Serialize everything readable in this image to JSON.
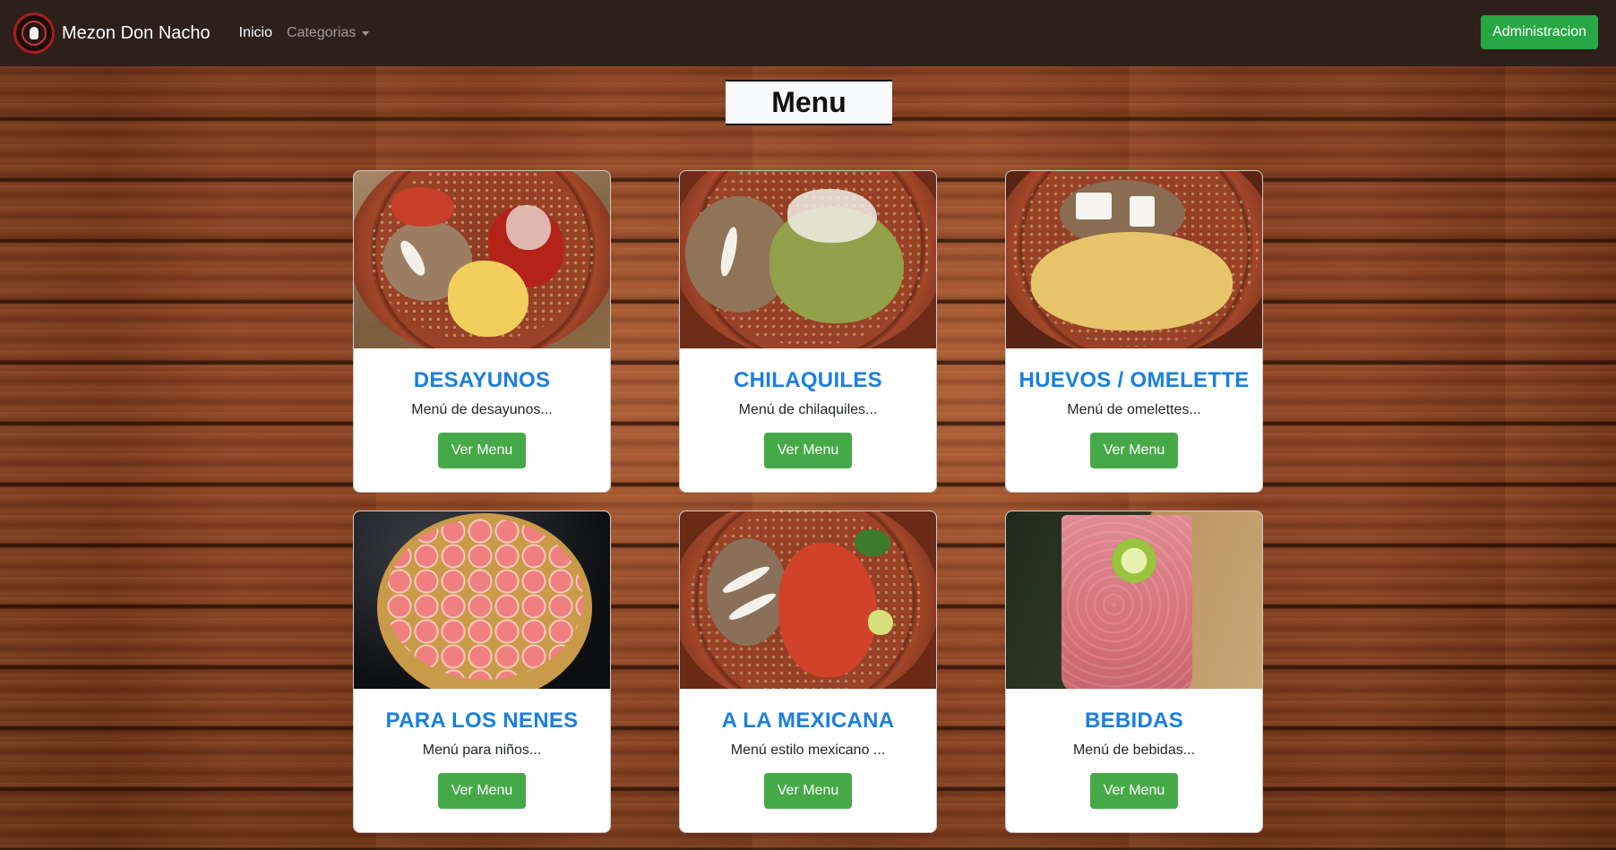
{
  "navbar": {
    "brand": "Mezon Don Nacho",
    "links": [
      {
        "label": "Inicio",
        "active": true
      },
      {
        "label": "Categorias",
        "dropdown": true
      }
    ],
    "admin_button": "Administracion"
  },
  "page_title": "Menu",
  "cards": [
    {
      "title": "DESAYUNOS",
      "text": "Menú de desayunos...",
      "button": "Ver Menu",
      "image": "breakfast-plate"
    },
    {
      "title": "CHILAQUILES",
      "text": "Menú de chilaquiles...",
      "button": "Ver Menu",
      "image": "chilaquiles-plate"
    },
    {
      "title": "HUEVOS / OMELETTE",
      "text": "Menú de omelettes...",
      "button": "Ver Menu",
      "image": "omelette-plate"
    },
    {
      "title": "PARA LOS NENES",
      "text": "Menú para niños...",
      "button": "Ver Menu",
      "image": "strawberry-pancake"
    },
    {
      "title": "A LA MEXICANA",
      "text": "Menú estilo mexicano ...",
      "button": "Ver Menu",
      "image": "mexican-plate"
    },
    {
      "title": "BEBIDAS",
      "text": "Menú de bebidas...",
      "button": "Ver Menu",
      "image": "drink-glass"
    }
  ],
  "colors": {
    "navbar_bg": "#2d1f1a",
    "title_blue": "#1a7fe0",
    "button_green": "#46a948",
    "admin_green": "#28a745"
  }
}
